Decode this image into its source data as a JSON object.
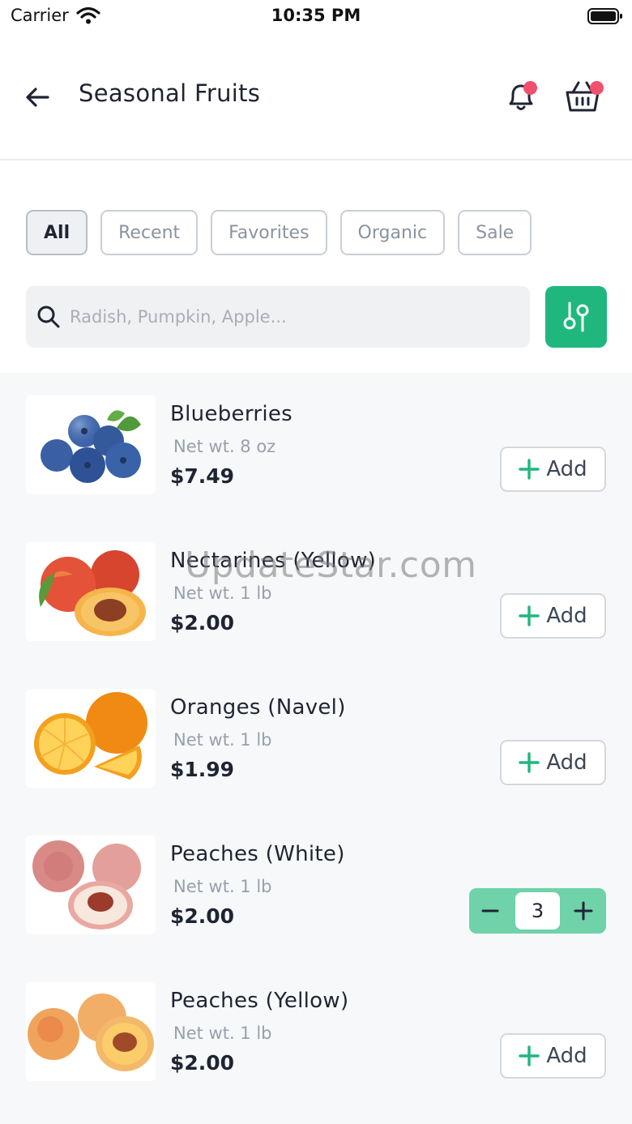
{
  "status_bar": {
    "carrier": "Carrier",
    "time": "10:35 PM"
  },
  "header": {
    "title": "Seasonal Fruits",
    "badge_color": "#f0506e"
  },
  "filters": {
    "chips": [
      "All",
      "Recent",
      "Favorites",
      "Organic",
      "Sale"
    ],
    "active": "All"
  },
  "search": {
    "placeholder": "Radish, Pumpkin, Apple...",
    "value": ""
  },
  "accent_color": "#1fb77e",
  "add_label": "Add",
  "products": [
    {
      "name": "Blueberries",
      "weight": "Net wt. 8 oz",
      "price": "$7.49",
      "quantity": 0
    },
    {
      "name": "Nectarines (Yellow)",
      "weight": "Net wt. 1 lb",
      "price": "$2.00",
      "quantity": 0
    },
    {
      "name": "Oranges (Navel)",
      "weight": "Net wt. 1 lb",
      "price": "$1.99",
      "quantity": 0
    },
    {
      "name": "Peaches (White)",
      "weight": "Net wt. 1 lb",
      "price": "$2.00",
      "quantity": "3"
    },
    {
      "name": "Peaches (Yellow)",
      "weight": "Net wt. 1 lb",
      "price": "$2.00",
      "quantity": 0
    }
  ],
  "watermark": "UpdateStar.com"
}
